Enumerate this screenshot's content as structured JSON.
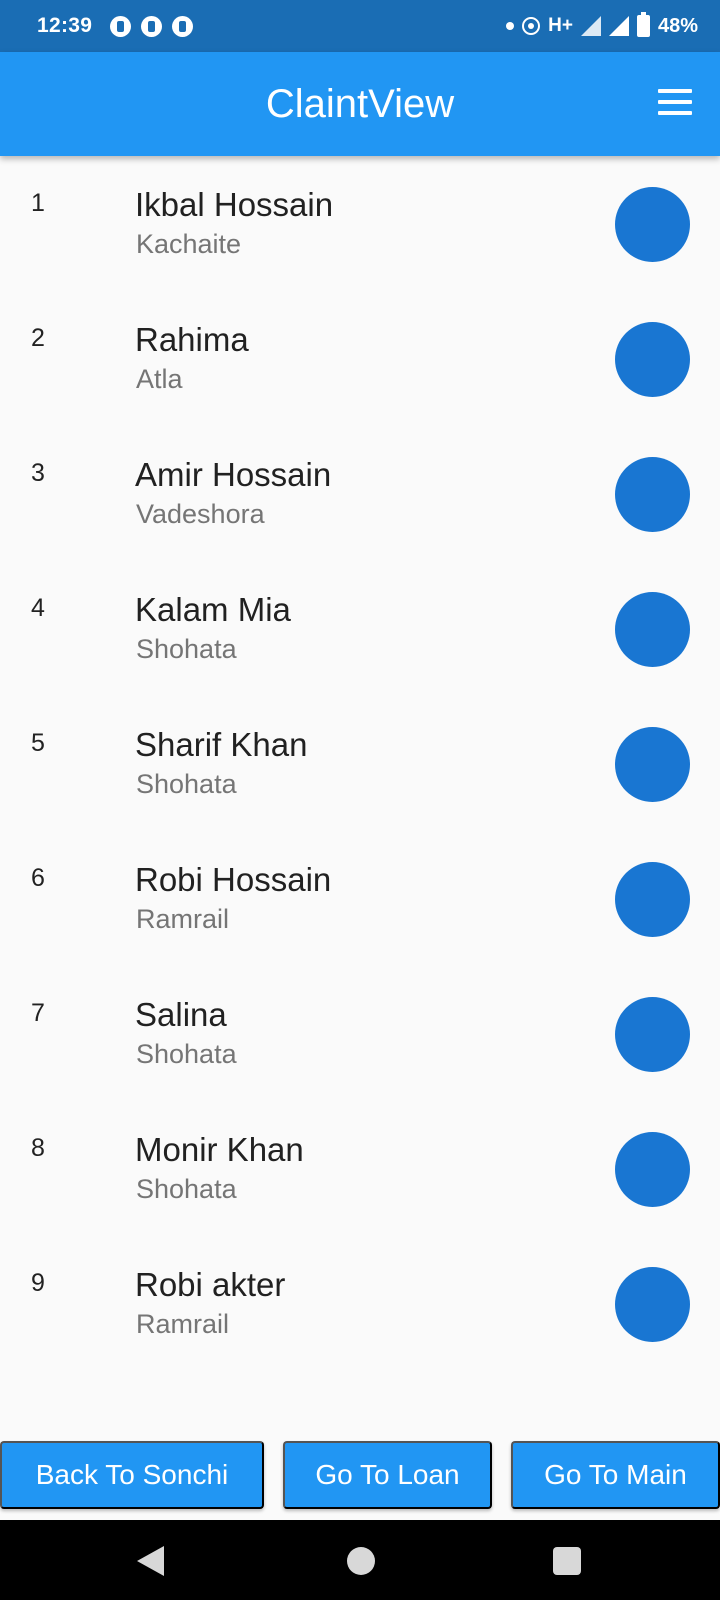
{
  "status_bar": {
    "time": "12:39",
    "network": "H+",
    "battery": "48%"
  },
  "app_bar": {
    "title": "ClaintView"
  },
  "clients": [
    {
      "index": "1",
      "name": "Ikbal Hossain",
      "place": "Kachaite"
    },
    {
      "index": "2",
      "name": "Rahima",
      "place": "Atla"
    },
    {
      "index": "3",
      "name": "Amir Hossain",
      "place": "Vadeshora"
    },
    {
      "index": "4",
      "name": "Kalam Mia",
      "place": "Shohata"
    },
    {
      "index": "5",
      "name": "Sharif Khan",
      "place": "Shohata"
    },
    {
      "index": "6",
      "name": "Robi Hossain",
      "place": "Ramrail"
    },
    {
      "index": "7",
      "name": "Salina",
      "place": "Shohata"
    },
    {
      "index": "8",
      "name": "Monir Khan",
      "place": "Shohata"
    },
    {
      "index": "9",
      "name": "Robi akter",
      "place": "Ramrail"
    }
  ],
  "buttons": {
    "back_to_sonchi": "Back To Sonchi",
    "go_to_loan": "Go To Loan",
    "go_to_main": "Go To Main"
  },
  "colors": {
    "status_bar": "#1a6db4",
    "app_bar": "#2196f3",
    "avatar": "#1976d2",
    "button": "#2196f3",
    "background": "#fafafa"
  },
  "icons": {
    "menu": "hamburger-menu-icon",
    "nav_back": "triangle-back-icon",
    "nav_home": "circle-home-icon",
    "nav_recent": "square-recent-icon"
  }
}
